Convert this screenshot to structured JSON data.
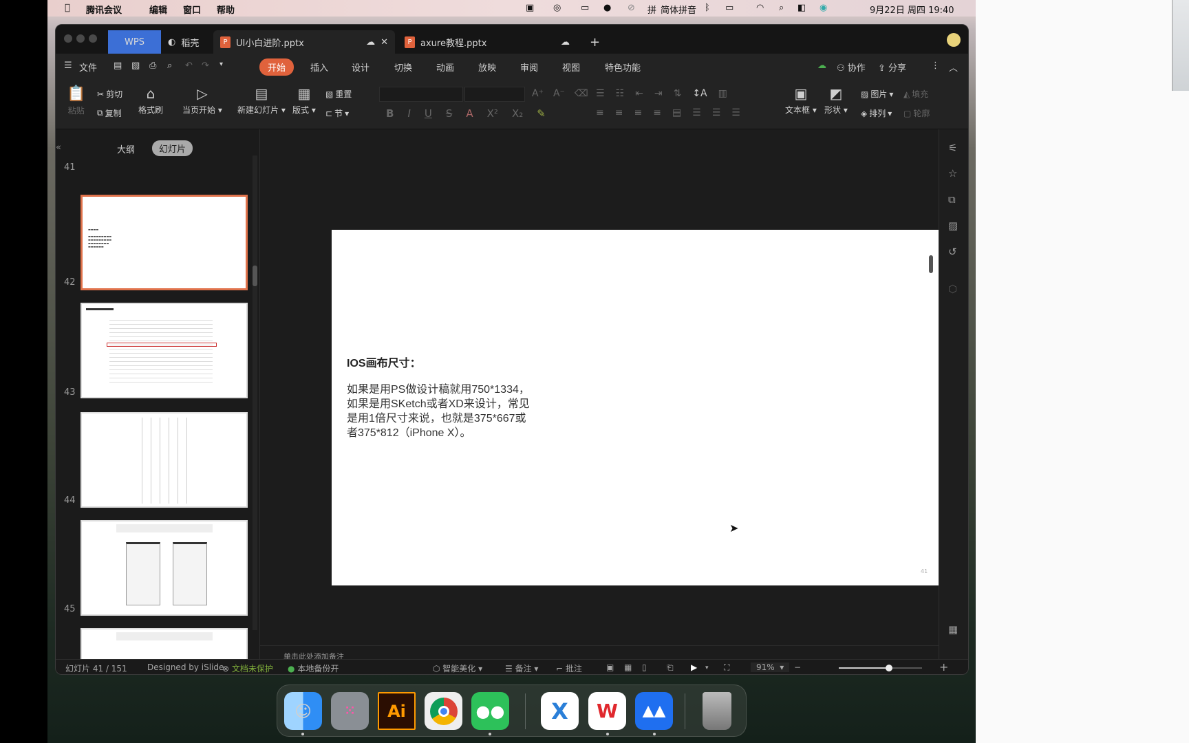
{
  "menubar": {
    "app": "腾讯会议",
    "items": [
      "编辑",
      "窗口",
      "帮助"
    ],
    "ime": "简体拼音",
    "datetime": "9月22日 周四 19:40"
  },
  "tabs": {
    "wps": "WPS",
    "daoke": "稻壳",
    "doc1": "UI小白进阶.pptx",
    "doc2": "axure教程.pptx",
    "new": "+"
  },
  "menu": {
    "file": "文件",
    "items": [
      "开始",
      "插入",
      "设计",
      "切换",
      "动画",
      "放映",
      "审阅",
      "视图",
      "特色功能"
    ],
    "active": "开始",
    "collab": "协作",
    "share": "分享"
  },
  "ribbon": {
    "paste": "粘贴",
    "cut": "剪切",
    "copy": "复制",
    "format_painter": "格式刷",
    "from_current": "当页开始",
    "new_slide": "新建幻灯片",
    "layout": "版式",
    "reset": "重置",
    "section": "节",
    "textbox": "文本框",
    "shape": "形状",
    "picture": "图片",
    "fill": "填充",
    "arrange": "排列",
    "outline": "轮廓"
  },
  "panel": {
    "outline_tab": "大纲",
    "slides_tab": "幻灯片",
    "slide_numbers": [
      "41",
      "42",
      "43",
      "44",
      "45"
    ]
  },
  "slide": {
    "title": "IOS画布尺寸：",
    "lines": [
      "如果是用PS做设计稿就用750*1334，",
      "如果是用SKetch或者XD来设计，常见",
      "是用1倍尺寸来说，也就是375*667或",
      "者375*812（iPhone X）。"
    ],
    "page_number": "41"
  },
  "notes": {
    "placeholder": "单击此处添加备注"
  },
  "status": {
    "slide_count": "幻灯片 41 / 151",
    "theme": "Designed by iSlide",
    "protect": "文档未保护",
    "backup": "本地备份开",
    "beautify": "智能美化",
    "notes": "备注",
    "comment": "批注",
    "zoom": "91%",
    "zoom_level": 0.6
  },
  "colors": {
    "accent": "#e0623c",
    "wps_tab": "#3c6fd6",
    "protect_green": "#7fae3a"
  }
}
